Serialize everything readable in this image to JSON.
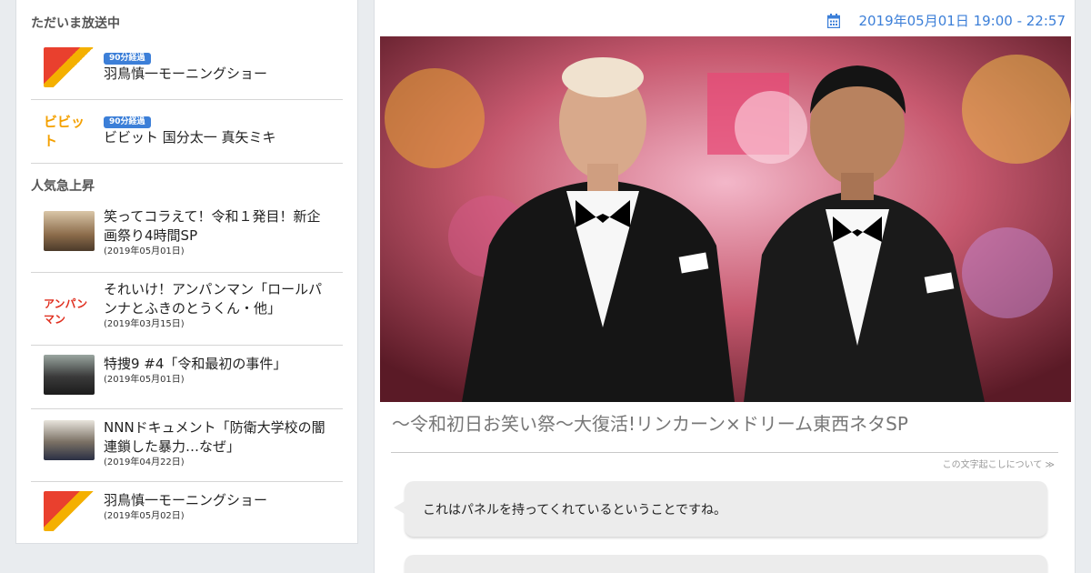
{
  "sidebar": {
    "live_heading": "ただいま放送中",
    "live_items": [
      {
        "badge": "90分経過",
        "title": "羽鳥慎一モーニングショー",
        "thumb": "morning-show-thumb"
      },
      {
        "badge": "90分経過",
        "title": "ビビット 国分太一 真矢ミキ",
        "thumb": "vivid-thumb",
        "thumb_text": "ビビット"
      }
    ],
    "popular_heading": "人気急上昇",
    "popular_items": [
      {
        "title_line1": "笑ってコラえて！令和１発目！新企",
        "title_line2": "画祭り4時間SP",
        "date": "(2019年05月01日)"
      },
      {
        "title_line1": "それいけ！アンパンマン「ロールパ",
        "title_line2": "ンナとふきのとうくん・他」",
        "date": "(2019年03月15日)",
        "thumb_text": "アンパンマン"
      },
      {
        "title_line1": "特捜9 #4「令和最初の事件」",
        "date": "(2019年05月01日)"
      },
      {
        "title_line1": "NNNドキュメント「防衛大学校の闇",
        "title_line2": "連鎖した暴力…なぜ」",
        "date": "(2019年04月22日)"
      },
      {
        "title_line1": "羽鳥慎一モーニングショー",
        "date": "(2019年05月02日)"
      }
    ]
  },
  "main": {
    "datetime": "2019年05月01日 19:00 - 22:57",
    "program_title": "～令和初日お笑い祭～大復活!リンカーン×ドリーム東西ネタSP",
    "about_link": "この文字起こしについて ≫",
    "transcript": [
      "これはパネルを持ってくれているということですね。",
      ""
    ]
  },
  "colors": {
    "accent": "#3c7fd8",
    "page_bg": "#e9ecef",
    "bubble_bg": "#ececec"
  }
}
